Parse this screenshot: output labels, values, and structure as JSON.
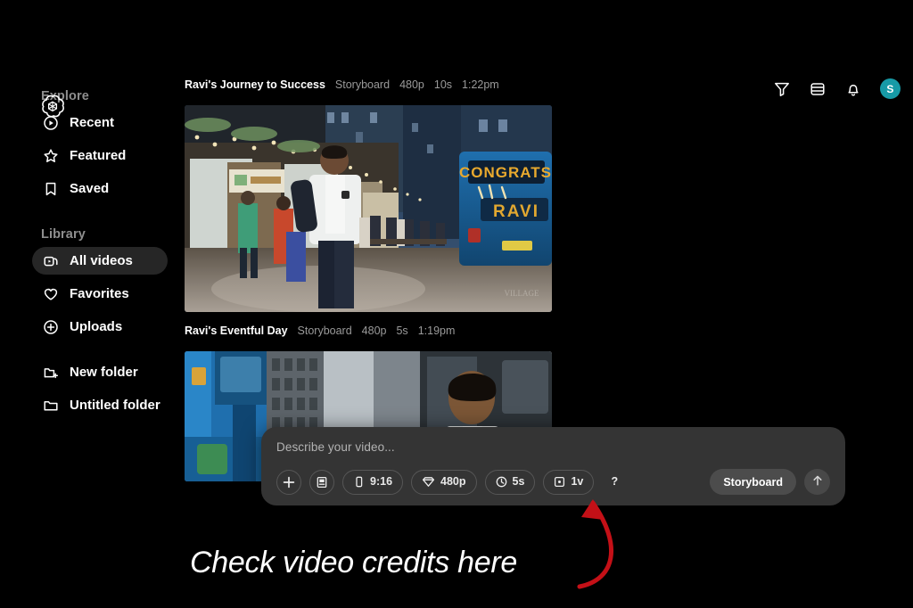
{
  "app": {
    "logo_icon": "openai-logo"
  },
  "sidebar": {
    "sections": [
      {
        "title": "Explore",
        "items": [
          {
            "label": "Recent",
            "icon": "play-circle-icon",
            "active": false
          },
          {
            "label": "Featured",
            "icon": "star-icon",
            "active": false
          },
          {
            "label": "Saved",
            "icon": "bookmark-icon",
            "active": false
          }
        ]
      },
      {
        "title": "Library",
        "items": [
          {
            "label": "All videos",
            "icon": "video-card-icon",
            "active": true
          },
          {
            "label": "Favorites",
            "icon": "heart-icon",
            "active": false
          },
          {
            "label": "Uploads",
            "icon": "plus-circle-icon",
            "active": false
          }
        ]
      },
      {
        "title": "",
        "items": [
          {
            "label": "New folder",
            "icon": "folder-plus-icon",
            "active": false
          },
          {
            "label": "Untitled folder",
            "icon": "folder-icon",
            "active": false
          }
        ]
      }
    ]
  },
  "topbar": {
    "icons": [
      {
        "name": "filter-icon"
      },
      {
        "name": "layers-icon"
      },
      {
        "name": "bell-icon"
      }
    ],
    "avatar": {
      "initial": "S",
      "color": "#179aa6"
    }
  },
  "feed": {
    "videos": [
      {
        "title": "Ravi's Journey to Success",
        "mode": "Storyboard",
        "resolution": "480p",
        "duration": "10s",
        "time": "1:22pm"
      },
      {
        "title": "Ravi's Eventful Day",
        "mode": "Storyboard",
        "resolution": "480p",
        "duration": "5s",
        "time": "1:19pm"
      }
    ]
  },
  "composer": {
    "placeholder": "Describe your video...",
    "chips": [
      {
        "name": "add-attachment",
        "icon": "plus-icon",
        "label": ""
      },
      {
        "name": "storyboard-card",
        "icon": "storyboard-icon",
        "label": ""
      },
      {
        "name": "aspect-ratio",
        "icon": "phone-icon",
        "label": "9:16"
      },
      {
        "name": "resolution",
        "icon": "diamond-icon",
        "label": "480p"
      },
      {
        "name": "duration",
        "icon": "clock-icon",
        "label": "5s"
      },
      {
        "name": "variations",
        "icon": "frame-dot-icon",
        "label": "1v"
      },
      {
        "name": "help",
        "icon": "question-icon",
        "label": "?"
      }
    ],
    "mode_button": "Storyboard",
    "send_icon": "arrow-up-icon"
  },
  "annotation": {
    "text": "Check video credits here",
    "arrow_color": "#c41017"
  }
}
